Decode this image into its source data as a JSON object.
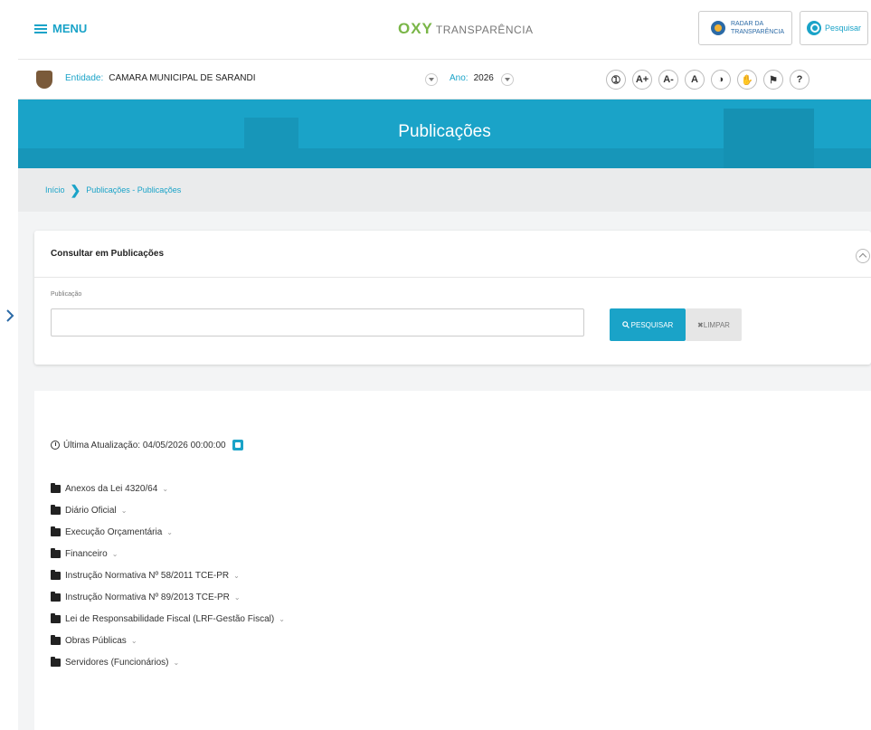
{
  "header": {
    "menu_label": "MENU",
    "logo_oxy": "OXY",
    "logo_text": "TRANSPARÊNCIA",
    "radar_label": "RADAR DA TRANSPARÊNCIA",
    "search_label": "Pesquisar"
  },
  "entity_bar": {
    "entity_key": "Entidade:",
    "entity_value": "CAMARA MUNICIPAL DE SARANDI",
    "year_key": "Ano:",
    "year_value": "2026",
    "a11y": [
      "➀",
      "A+",
      "A-",
      "A",
      "◑",
      "✋",
      "⚑",
      "?"
    ]
  },
  "banner": {
    "title": "Publicações"
  },
  "breadcrumb": {
    "home": "Início",
    "separator": "❯",
    "current": "Publicações - Publicações"
  },
  "search_card": {
    "title": "Consultar em Publicações",
    "field_label": "Publicação",
    "field_value": "",
    "search_button": "PESQUISAR",
    "clear_button": "✖LIMPAR"
  },
  "content": {
    "updated": "Última Atualização: 04/05/2026 00:00:00",
    "folders": [
      "Anexos da Lei 4320/64",
      "Diário Oficial",
      "Execução Orçamentária",
      "Financeiro",
      "Instrução Normativa Nº 58/2011 TCE-PR",
      "Instrução Normativa Nº 89/2013 TCE-PR",
      "Lei de Responsabilidade Fiscal (LRF-Gestão Fiscal)",
      "Obras Públicas",
      "Servidores (Funcionários)"
    ],
    "chevron": "⌄"
  },
  "colors": {
    "accent": "#1aa3c8",
    "logo_green": "#7ab648"
  }
}
